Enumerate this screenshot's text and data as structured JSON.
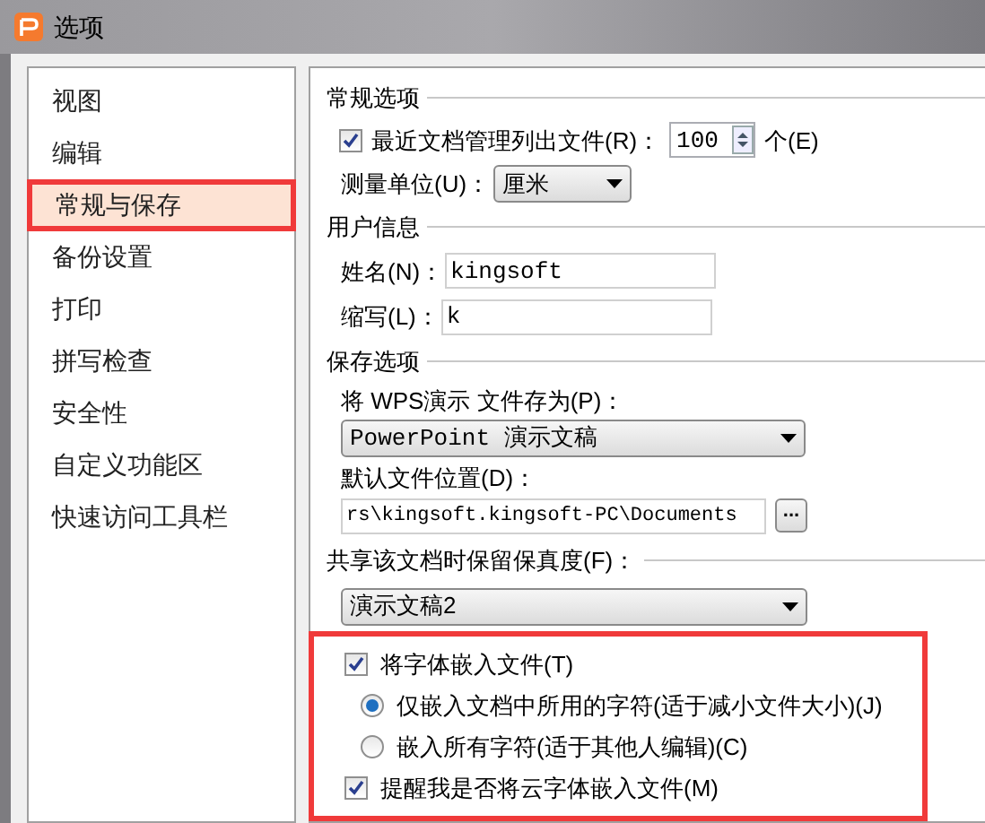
{
  "window": {
    "title": "选项"
  },
  "sidebar": {
    "items": [
      {
        "label": "视图",
        "selected": false
      },
      {
        "label": "编辑",
        "selected": false
      },
      {
        "label": "常规与保存",
        "selected": true
      },
      {
        "label": "备份设置",
        "selected": false
      },
      {
        "label": "打印",
        "selected": false
      },
      {
        "label": "拼写检查",
        "selected": false
      },
      {
        "label": "安全性",
        "selected": false
      },
      {
        "label": "自定义功能区",
        "selected": false
      },
      {
        "label": "快速访问工具栏",
        "selected": false
      }
    ]
  },
  "general": {
    "title": "常规选项",
    "recent_files": {
      "checked": true,
      "label": "最近文档管理列出文件(R)：",
      "value": "100",
      "unit": "个(E)"
    },
    "measure_unit": {
      "label": "测量单位(U)：",
      "value": "厘米"
    }
  },
  "user_info": {
    "title": "用户信息",
    "name": {
      "label": "姓名(N)：",
      "value": "kingsoft"
    },
    "initials": {
      "label": "缩写(L)：",
      "value": "k"
    }
  },
  "save_options": {
    "title": "保存选项",
    "save_as": {
      "label": "将 WPS演示 文件存为(P)：",
      "value": "PowerPoint 演示文稿"
    },
    "default_location": {
      "label": "默认文件位置(D)：",
      "value": "rs\\kingsoft.kingsoft-PC\\Documents",
      "browse": "..."
    }
  },
  "fidelity": {
    "title": "共享该文档时保留保真度(F)：",
    "value": "演示文稿2",
    "highlighted": true,
    "embed_fonts": {
      "checked": true,
      "label": "将字体嵌入文件(T)"
    },
    "embed_modes": [
      {
        "label": "仅嵌入文档中所用的字符(适于减小文件大小)(J)",
        "selected": true
      },
      {
        "label": "嵌入所有字符(适于其他人编辑)(C)",
        "selected": false
      }
    ],
    "remind_cloud": {
      "checked": true,
      "label": "提醒我是否将云字体嵌入文件(M)"
    }
  }
}
